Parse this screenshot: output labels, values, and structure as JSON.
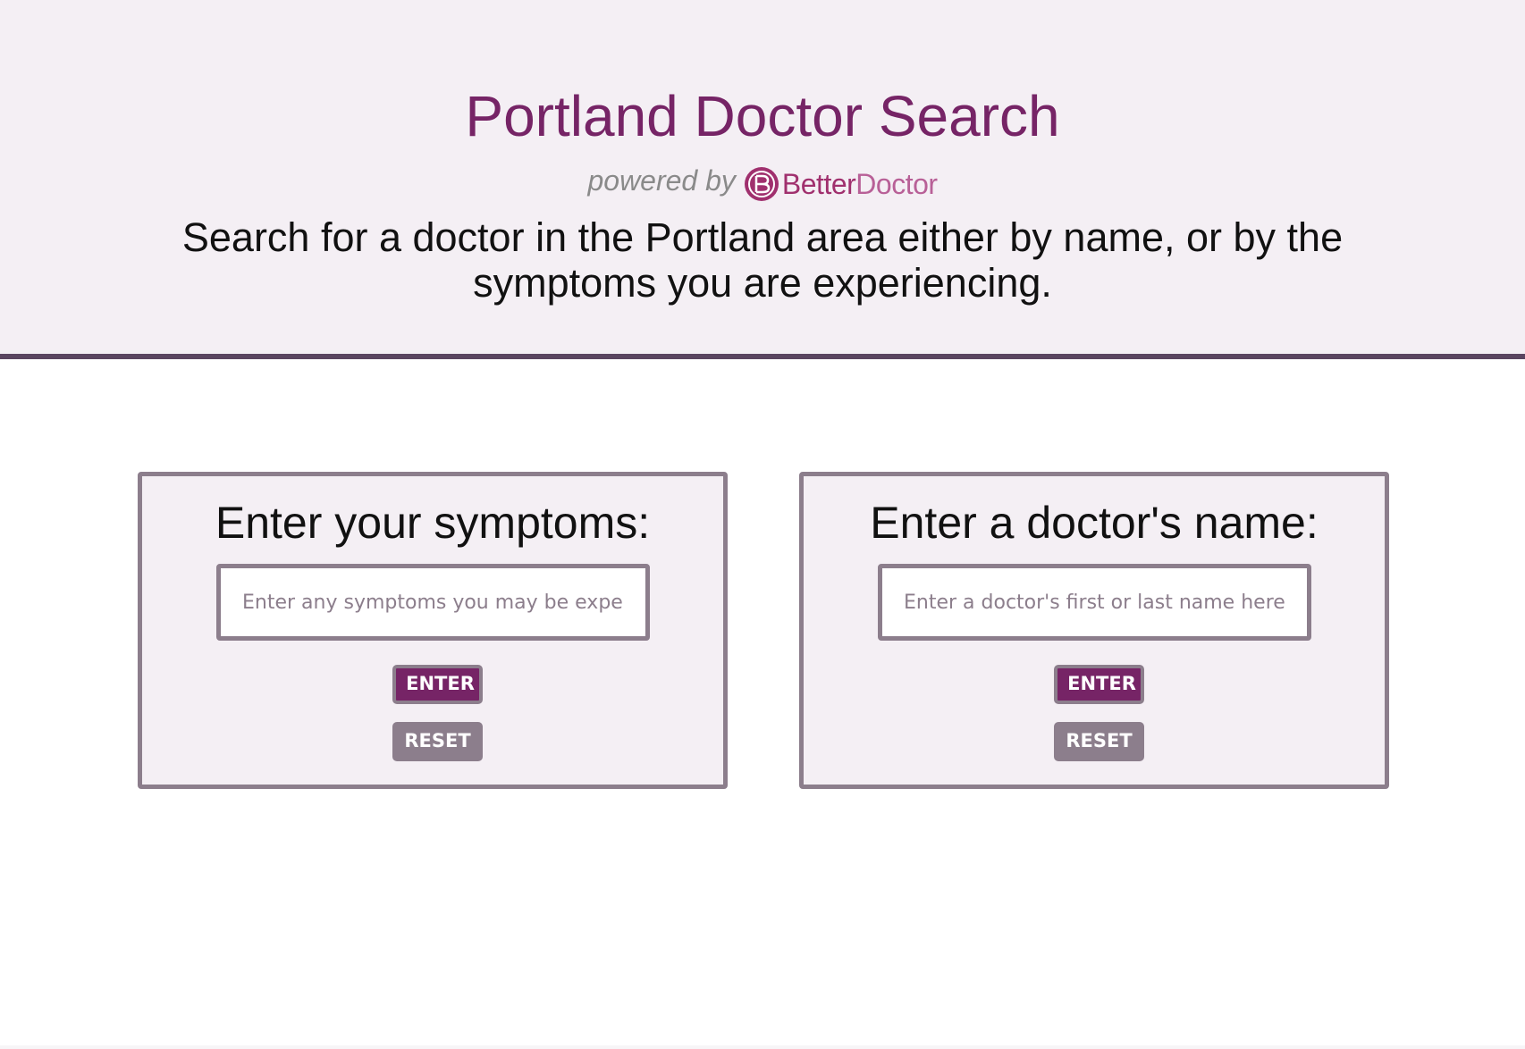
{
  "header": {
    "title": "Portland Doctor Search",
    "powered_by": "powered by",
    "logo": {
      "icon": "betterdoctor-logo-icon",
      "brand_part1": "Better",
      "brand_part2": "Doctor"
    },
    "tagline": "Search for a doctor in the Portland area either by name, or by the symptoms you are experiencing."
  },
  "symptoms_panel": {
    "heading": "Enter your symptoms:",
    "input_placeholder": "Enter any symptoms you may be experiencing...",
    "input_value": "",
    "enter_label": "ENTER",
    "reset_label": "RESET"
  },
  "name_panel": {
    "heading": "Enter a doctor's name:",
    "input_placeholder": "Enter a doctor's first or last name here...",
    "input_value": "",
    "enter_label": "ENTER",
    "reset_label": "RESET"
  },
  "colors": {
    "brand_purple": "#762466",
    "header_bg": "#f4eff4",
    "border_gray": "#8c7e8c",
    "header_rule": "#5a4560"
  }
}
